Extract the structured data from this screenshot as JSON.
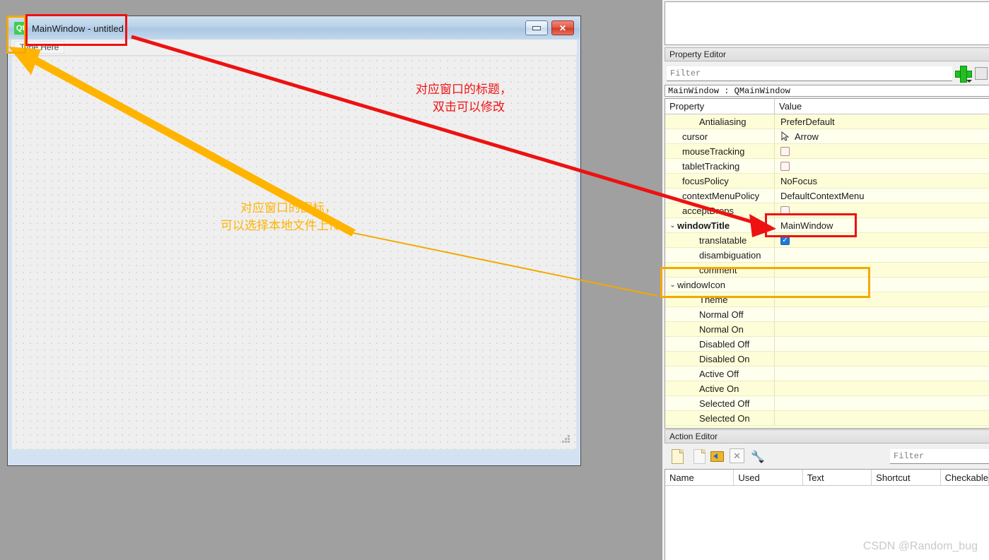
{
  "form_window": {
    "title": "MainWindow - untitled",
    "logo_text": "Qt",
    "menu_type_here": "Type Here",
    "minimize_label": "",
    "close_label": "✕"
  },
  "property_editor": {
    "dock_title": "Property Editor",
    "filter_placeholder": "Filter",
    "object_line": "MainWindow : QMainWindow",
    "columns": [
      "Property",
      "Value"
    ],
    "rows": [
      {
        "name": "Antialiasing",
        "value": "PreferDefault",
        "indent": 2,
        "type": "text",
        "bold": false,
        "chevron": false
      },
      {
        "name": "cursor",
        "value": "Arrow",
        "indent": 1,
        "type": "cursor",
        "bold": false,
        "chevron": false
      },
      {
        "name": "mouseTracking",
        "value": "",
        "indent": 1,
        "type": "checkbox",
        "checked": false,
        "bold": false,
        "chevron": false
      },
      {
        "name": "tabletTracking",
        "value": "",
        "indent": 1,
        "type": "checkbox",
        "checked": false,
        "bold": false,
        "chevron": false
      },
      {
        "name": "focusPolicy",
        "value": "NoFocus",
        "indent": 1,
        "type": "text",
        "bold": false,
        "chevron": false
      },
      {
        "name": "contextMenuPolicy",
        "value": "DefaultContextMenu",
        "indent": 1,
        "type": "text",
        "bold": false,
        "chevron": false
      },
      {
        "name": "acceptDrops",
        "value": "",
        "indent": 1,
        "type": "checkbox",
        "checked": false,
        "bold": false,
        "chevron": false
      },
      {
        "name": "windowTitle",
        "value": "MainWindow",
        "indent": 0,
        "type": "text",
        "bold": true,
        "chevron": true
      },
      {
        "name": "translatable",
        "value": "",
        "indent": 2,
        "type": "checkbox",
        "checked": true,
        "bold": false,
        "chevron": false
      },
      {
        "name": "disambiguation",
        "value": "",
        "indent": 2,
        "type": "text",
        "bold": false,
        "chevron": false
      },
      {
        "name": "comment",
        "value": "",
        "indent": 2,
        "type": "text",
        "bold": false,
        "chevron": false
      },
      {
        "name": "windowIcon",
        "value": "",
        "indent": 0,
        "type": "text",
        "bold": false,
        "chevron": true
      },
      {
        "name": "Theme",
        "value": "",
        "indent": 2,
        "type": "text",
        "bold": false,
        "chevron": false
      },
      {
        "name": "Normal Off",
        "value": "",
        "indent": 2,
        "type": "text",
        "bold": false,
        "chevron": false
      },
      {
        "name": "Normal On",
        "value": "",
        "indent": 2,
        "type": "text",
        "bold": false,
        "chevron": false
      },
      {
        "name": "Disabled Off",
        "value": "",
        "indent": 2,
        "type": "text",
        "bold": false,
        "chevron": false
      },
      {
        "name": "Disabled On",
        "value": "",
        "indent": 2,
        "type": "text",
        "bold": false,
        "chevron": false
      },
      {
        "name": "Active Off",
        "value": "",
        "indent": 2,
        "type": "text",
        "bold": false,
        "chevron": false
      },
      {
        "name": "Active On",
        "value": "",
        "indent": 2,
        "type": "text",
        "bold": false,
        "chevron": false
      },
      {
        "name": "Selected Off",
        "value": "",
        "indent": 2,
        "type": "text",
        "bold": false,
        "chevron": false
      },
      {
        "name": "Selected On",
        "value": "",
        "indent": 2,
        "type": "text",
        "bold": false,
        "chevron": false
      }
    ]
  },
  "action_editor": {
    "dock_title": "Action Editor",
    "filter_placeholder": "Filter",
    "toolbar": [
      {
        "icon": "new-action-icon",
        "label": "New"
      },
      {
        "icon": "copy-action-icon",
        "label": "Copy"
      },
      {
        "icon": "open-folder-icon",
        "label": "Open"
      },
      {
        "icon": "delete-action-icon",
        "label": "Delete"
      },
      {
        "icon": "configure-wrench-icon",
        "label": "Configure"
      }
    ],
    "columns": [
      "Name",
      "Used",
      "Text",
      "Shortcut",
      "Checkable"
    ]
  },
  "annotations": {
    "red_text_line1": "对应窗口的标题，",
    "red_text_line2": "双击可以修改",
    "orange_text_line1": "对应窗口的图标，",
    "orange_text_line2": "可以选择本地文件上传",
    "red_color": "#ee1111",
    "orange_color": "#f5a800"
  },
  "watermark": "CSDN @Random_bug"
}
